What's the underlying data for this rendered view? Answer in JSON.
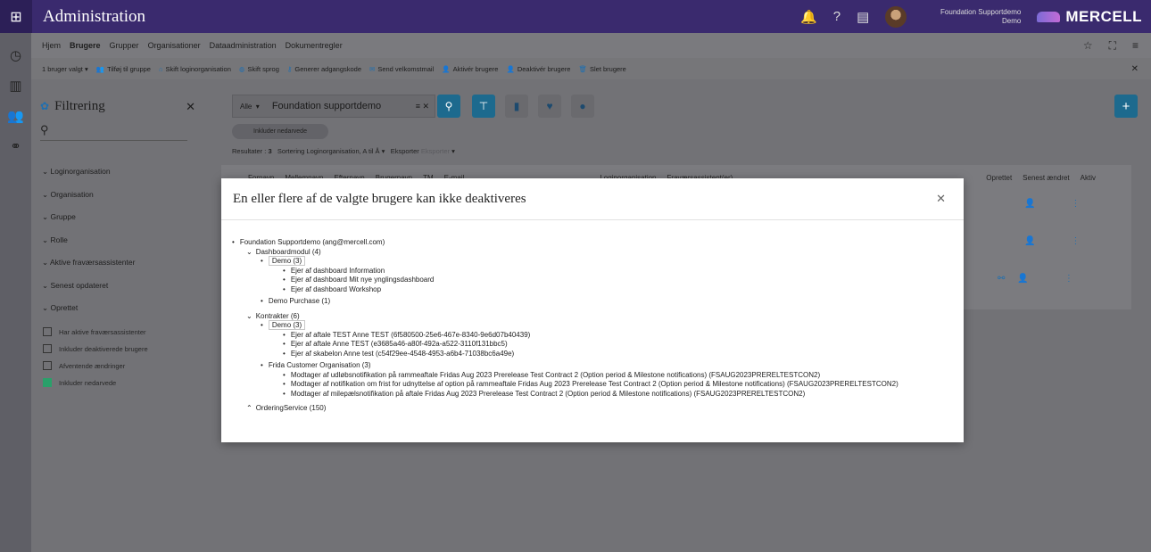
{
  "app": {
    "title": "Administration",
    "user_name": "Foundation Supportdemo",
    "user_org": "Demo",
    "brand": "MERCELL"
  },
  "nav": {
    "tabs": [
      "Hjem",
      "Brugere",
      "Grupper",
      "Organisationer",
      "Dataadministration",
      "Dokumentregler"
    ],
    "active": "Brugere"
  },
  "actions": {
    "selected": "1 bruger valgt",
    "items": [
      "Tilføj til gruppe",
      "Skift loginorganisation",
      "Skift sprog",
      "Generer adgangskode",
      "Send velkomstmail",
      "Aktivér brugere",
      "Deaktivér brugere",
      "Slet brugere"
    ]
  },
  "filter": {
    "title": "Filtrering",
    "sections": [
      "Loginorganisation",
      "Organisation",
      "Gruppe",
      "Rolle",
      "Aktive fraværsassistenter",
      "Senest opdateret",
      "Oprettet"
    ],
    "checks": [
      {
        "label": "Har aktive fraværsassistenter",
        "checked": false
      },
      {
        "label": "Inkluder deaktiverede brugere",
        "checked": false
      },
      {
        "label": "Afventende ændringer",
        "checked": false
      },
      {
        "label": "Inkluder nedarvede",
        "checked": true
      }
    ]
  },
  "search": {
    "scope": "Alle",
    "value": "Foundation supportdemo",
    "chip": "Inkluder nedarvede",
    "results_label": "Resultater :",
    "results_count": "3",
    "sort_label": "Sortering",
    "sort_value": "Loginorganisation, A til Å",
    "export_label": "Eksporter",
    "export_value": "Eksporter"
  },
  "table": {
    "headers": [
      "Fornavn",
      "Mellemnavn",
      "Efternavn",
      "Brugernavn",
      "TM",
      "E-mail",
      "Loginorganisation",
      "Fraværsassistent(er)",
      "Oprettet",
      "Senest ændret",
      "Aktiv"
    ]
  },
  "modal": {
    "title": "En eller flere af de valgte brugere kan ikke deaktiveres",
    "user": "Foundation Supportdemo (ang@mercell.com)",
    "dash_group": "Dashboardmodul (4)",
    "dash_demo": "Demo (3)",
    "dash_items": [
      "Ejer af dashboard Information",
      "Ejer af dashboard Mit nye ynglingsdashboard",
      "Ejer af dashboard Workshop"
    ],
    "dash_purchase": "Demo Purchase (1)",
    "contracts_group": "Kontrakter (6)",
    "contracts_demo": "Demo (3)",
    "contracts_items": [
      "Ejer af aftale TEST Anne TEST (6f580500-25e6-467e-8340-9e6d07b40439)",
      "Ejer af aftale Anne TEST (e3685a46-a80f-492a-a522-3110f131bbc5)",
      "Ejer af skabelon Anne test (c54f29ee-4548-4953-a6b4-71038bc6a49e)"
    ],
    "frida": "Frida Customer Organisation (3)",
    "frida_items": [
      "Modtager af udløbsnotifikation på rammeaftale Fridas Aug 2023 Prerelease Test Contract 2 (Option period & Milestone notifications) (FSAUG2023PRERELTESTCON2)",
      "Modtager af notifikation om frist for udnyttelse af option på rammeaftale Fridas Aug 2023 Prerelease Test Contract 2 (Option period & Milestone notifications) (FSAUG2023PRERELTESTCON2)",
      "Modtager af milepælsnotifikation på aftale Fridas Aug 2023 Prerelease Test Contract 2 (Option period & Milestone notifications) (FSAUG2023PRERELTESTCON2)"
    ],
    "ordering": "OrderingService (150)"
  }
}
